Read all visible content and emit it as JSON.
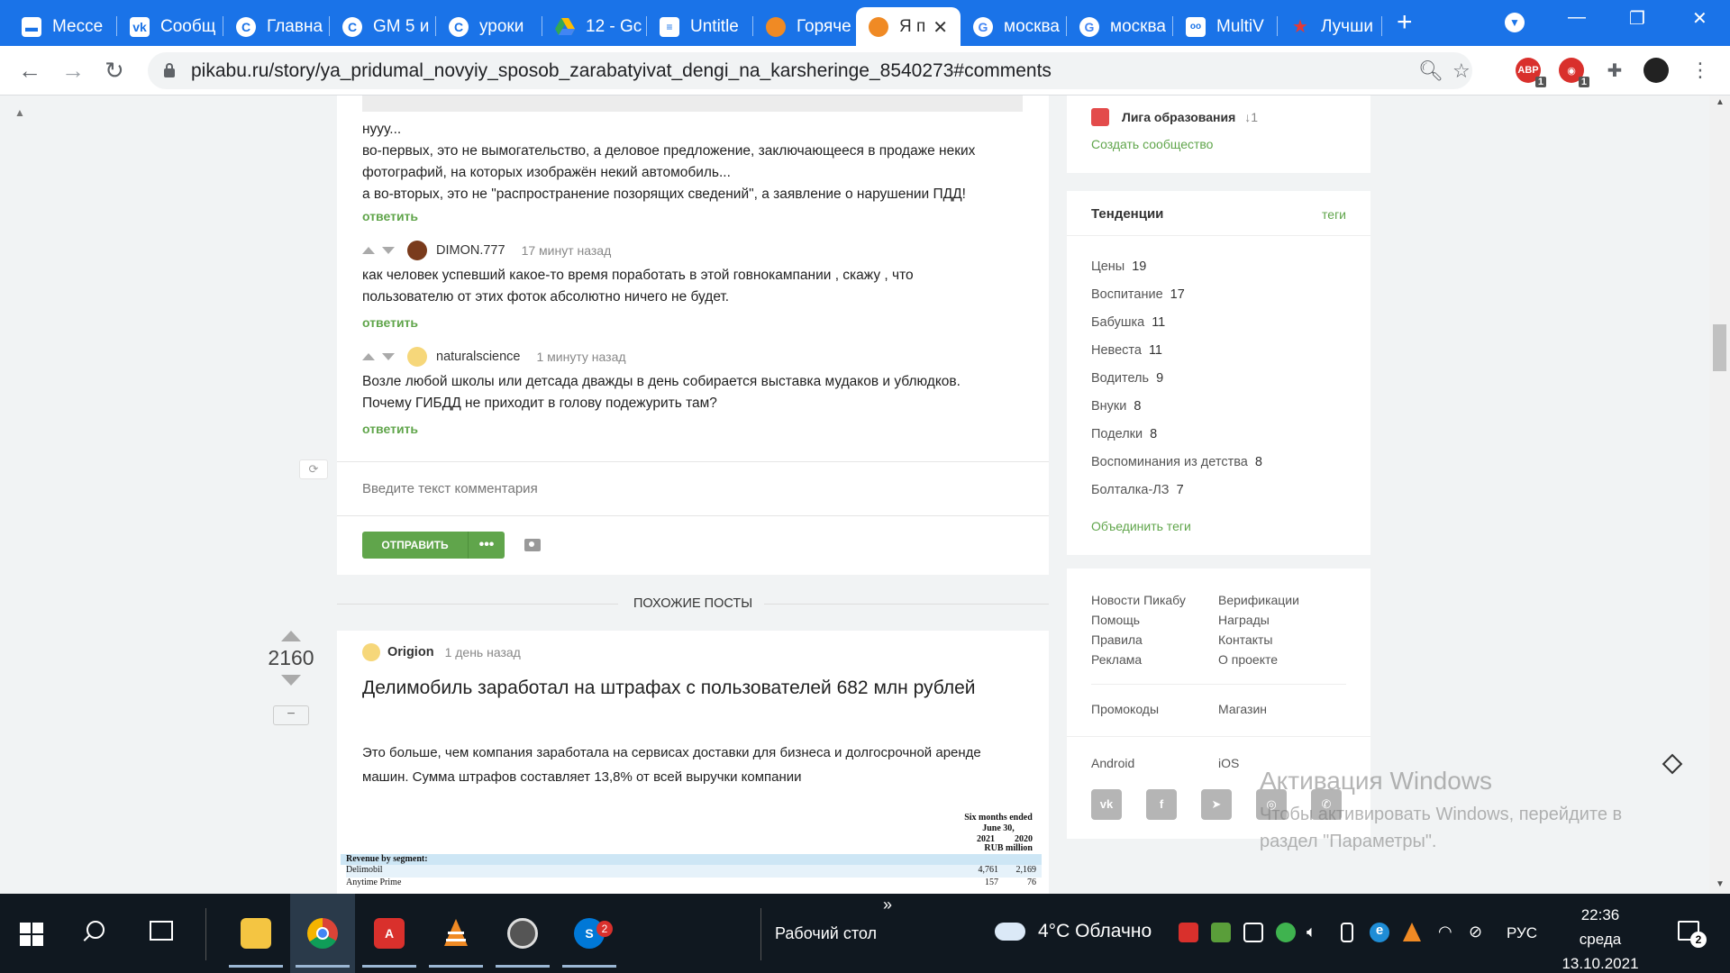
{
  "browser": {
    "tabs": [
      {
        "label": "Мессе",
        "favicon": "messenger-icon",
        "color": "#ffffff"
      },
      {
        "label": "Сообщ",
        "favicon": "vk-icon",
        "color": "#ffffff"
      },
      {
        "label": "Главна",
        "favicon": "c-icon",
        "color": "#ffffff"
      },
      {
        "label": "GM 5 и",
        "favicon": "c-icon",
        "color": "#ffffff"
      },
      {
        "label": "уроки",
        "favicon": "c-icon",
        "color": "#ffffff"
      },
      {
        "label": "12 - Gc",
        "favicon": "drive-icon",
        "color": "#ffffff"
      },
      {
        "label": "Untitle",
        "favicon": "docs-icon",
        "color": "#ffffff"
      },
      {
        "label": "Горяче",
        "favicon": "pikabu-icon",
        "color": "#ffffff"
      },
      {
        "label": "Я п",
        "favicon": "pikabu-icon",
        "color": "#ffffff",
        "active": true
      },
      {
        "label": "москва",
        "favicon": "google-icon",
        "color": "#ffffff"
      },
      {
        "label": "москва",
        "favicon": "google-icon",
        "color": "#ffffff"
      },
      {
        "label": "MultiV",
        "favicon": "multiv-icon",
        "color": "#ffffff"
      },
      {
        "label": "Лучши",
        "favicon": "star-icon",
        "color": "#ffffff"
      }
    ],
    "new_tab": "+",
    "url": "pikabu.ru/story/ya_pridumal_novyiy_sposob_zarabatyivat_dengi_na_karsheringe_8540273#comments",
    "extensions": [
      {
        "name": "abp-icon",
        "label": "ABP",
        "badge": "1"
      },
      {
        "name": "opera-shield-icon",
        "label": "",
        "badge": "1"
      },
      {
        "name": "puzzle-icon",
        "label": "",
        "badge": ""
      },
      {
        "name": "profile-avatar-icon",
        "label": "",
        "badge": ""
      }
    ]
  },
  "comments": [
    {
      "text_lines": [
        "нууу...",
        "во-первых, это не вымогательство, а деловое предложение, заключающееся в продаже неких",
        "фотографий, на которых изображён некий автомобиль...",
        "а во-вторых, это не \"распространение позорящих сведений\", а заявление о нарушении ПДД!"
      ],
      "reply": "ответить"
    },
    {
      "author": "DIMON.777",
      "time": "17 минут назад",
      "text_lines": [
        "как человек успевший какое-то время поработать в этой говнокампании , скажу , что",
        "пользователю от этих фоток абсолютно ничего не будет."
      ],
      "reply": "ответить"
    },
    {
      "author": "naturalscience",
      "time": "1 минуту назад",
      "text_lines": [
        "Возле любой школы или детсада дважды в день собирается выставка мудаков и ублюдков.",
        "Почему ГИБДД не приходит в голову подежурить там?"
      ],
      "reply": "ответить"
    }
  ],
  "comment_form": {
    "placeholder": "Введите текст комментария",
    "send_label": "ОТПРАВИТЬ",
    "more_label": "•••"
  },
  "similar_posts_label": "ПОХОЖИЕ ПОСТЫ",
  "post": {
    "rating": "2160",
    "minus_label": "−",
    "author": "Origion",
    "time": "1 день назад",
    "title": "Делимобиль заработал на штрафах с пользователей 682 млн рублей",
    "body": "Это больше, чем компания заработала на сервисах доставки для бизнеса и долгосрочной аренде машин. Сумма штрафов составляет 13,8% от всей выручки компании",
    "report": {
      "header": "Six months ended June 30,",
      "years": [
        "2021",
        "2020"
      ],
      "unit": "RUB million",
      "section": "Revenue by segment:",
      "rows": [
        {
          "label": "Delimobil",
          "v2021": "4,761",
          "v2020": "2,169"
        },
        {
          "label": "Anytime Prime",
          "v2021": "157",
          "v2020": "76"
        }
      ]
    }
  },
  "sidebar": {
    "community": {
      "name": "Лига образования",
      "count": "↓1",
      "create": "Создать сообщество"
    },
    "trends": {
      "title": "Тенденции",
      "tags_link": "теги",
      "items": [
        {
          "label": "Цены",
          "count": "19"
        },
        {
          "label": "Воспитание",
          "count": "17"
        },
        {
          "label": "Бабушка",
          "count": "11"
        },
        {
          "label": "Невеста",
          "count": "11"
        },
        {
          "label": "Водитель",
          "count": "9"
        },
        {
          "label": "Внуки",
          "count": "8"
        },
        {
          "label": "Поделки",
          "count": "8"
        },
        {
          "label": "Воспоминания из детства",
          "count": "8"
        },
        {
          "label": "Болталка-ЛЗ",
          "count": "7"
        }
      ],
      "merge": "Объединить теги"
    },
    "footer_links": {
      "col1": [
        "Новости Пикабу",
        "Помощь",
        "Правила",
        "Реклама"
      ],
      "col2": [
        "Верификации",
        "Награды",
        "Контакты",
        "О проекте"
      ],
      "promo": "Промокоды",
      "shop": "Магазин",
      "android": "Android",
      "ios": "iOS"
    }
  },
  "watermark": {
    "title": "Активация Windows",
    "text": "Чтобы активировать Windows, перейдите в раздел \"Параметры\"."
  },
  "taskbar": {
    "desktop_label": "Рабочий стол",
    "chevron": "»",
    "weather": "4°C  Облачно",
    "lang": "РУС",
    "time": "22:36",
    "weekday": "среда",
    "date": "13.10.2021",
    "notif_count": "2",
    "skype_badge": "2"
  }
}
